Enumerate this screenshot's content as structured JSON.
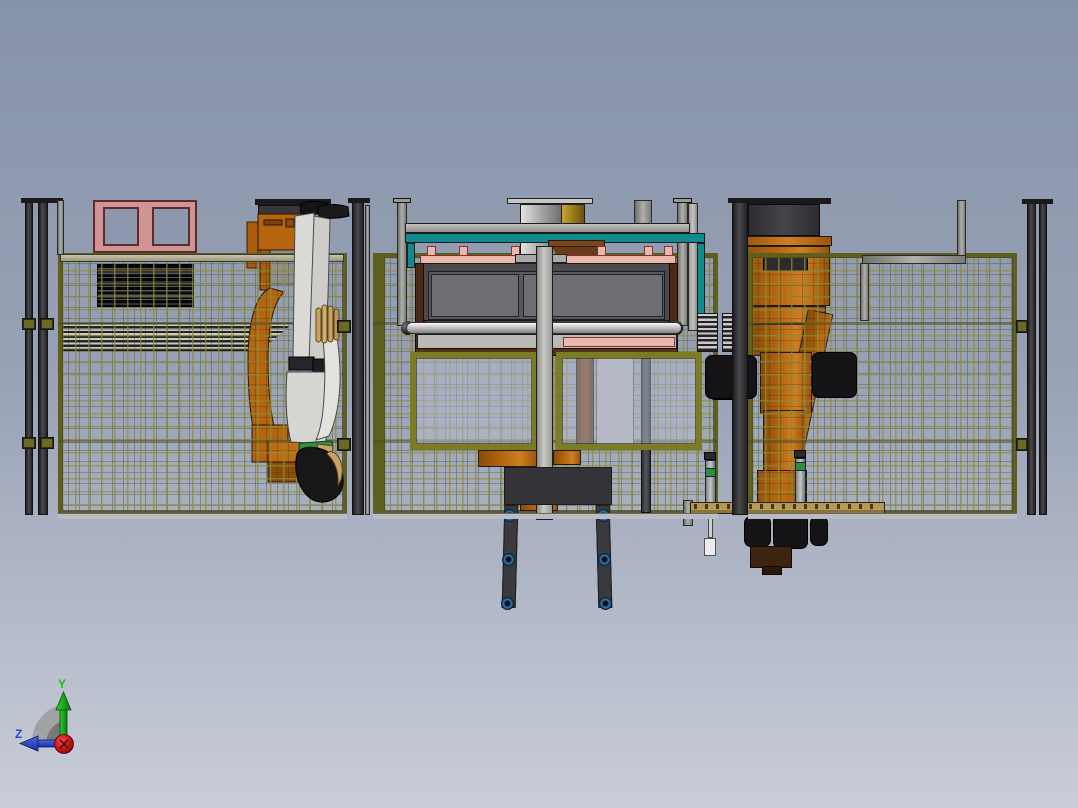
{
  "viewport": {
    "kind": "cad-3d-viewport",
    "view": "bottom-flipped"
  },
  "triad": {
    "y_label": "Y",
    "z_label": "Z"
  },
  "parts": {
    "left_robot": "industrial-robot-arm",
    "right_robot": "industrial-robot-arm",
    "operator": "human-mannequin-inverted",
    "positioner": "workpiece-table-with-roller",
    "fence": "safety-fence-mesh-panels",
    "control_window": "pink-window-frame",
    "vent": "black-louver-grill",
    "tool_rest": "tan-plank-fixture"
  },
  "colors": {
    "bg_top": "#8793aa",
    "bg_bottom": "#c9cdd8",
    "fence_frame": "#5e5e1e",
    "mesh_wire": "#8c8c3c",
    "post_dark": "#323236",
    "robot_orange": "#b5650f",
    "robot_orange_light": "#d07e22",
    "robot_orange_dark": "#8a4c08",
    "teal": "#0f8a8e",
    "pink_panel": "#cf9494",
    "pink_trim": "#edb6ab",
    "table_gray": "#4a4a4e",
    "brown": "#6b3a16",
    "gold": "#b08c20",
    "human_white": "#d8d8d4",
    "skin": "#c9a365",
    "collar_green": "#2f8f3f",
    "axis_y_green": "#1ec41e",
    "axis_z_blue": "#2747d8",
    "origin_red": "#cc1414",
    "bolt_blue": "#2e7fc0",
    "plank_tan": "#b29a58",
    "motor_black": "#161618"
  }
}
